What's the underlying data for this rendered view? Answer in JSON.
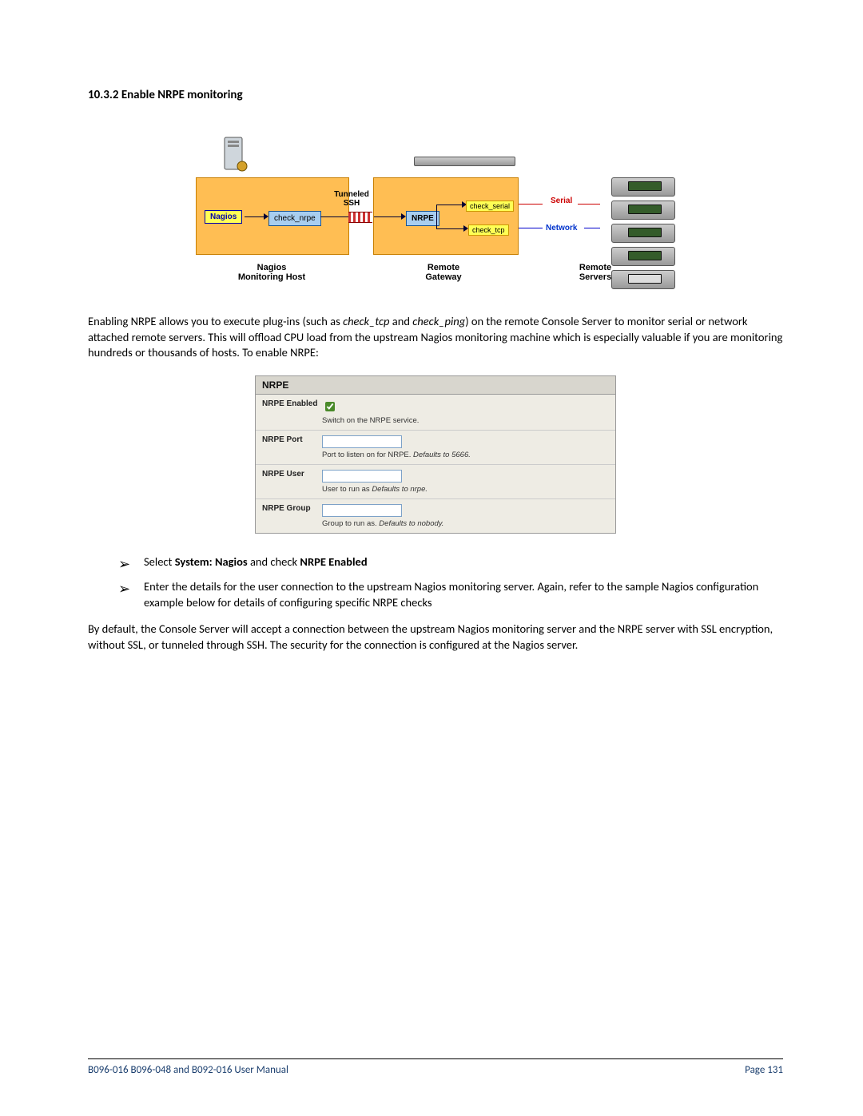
{
  "heading": "10.3.2  Enable NRPE monitoring",
  "diagram": {
    "nagios": "Nagios",
    "check_nrpe": "check_nrpe",
    "nrpe": "NRPE",
    "tunneled": "Tunneled\nSSH",
    "check_serial": "check_serial",
    "check_tcp": "check_tcp",
    "serial": "Serial",
    "network": "Network",
    "label_host": "Nagios\nMonitoring Host",
    "label_gateway": "Remote\nGateway",
    "label_servers": "Remote\nServers"
  },
  "para1_a": "Enabling NRPE allows you to execute plug-ins (such as ",
  "para1_i1": "check_tcp",
  "para1_b": " and ",
  "para1_i2": "check_ping",
  "para1_c": ") on the remote Console Server to monitor serial or network attached remote servers. This will offload CPU load from the upstream Nagios monitoring machine which is especially valuable if you are monitoring hundreds or thousands of hosts. To enable NRPE:",
  "form": {
    "title": "NRPE",
    "rows": {
      "enabled": {
        "label": "NRPE Enabled",
        "help": "Switch on the NRPE service."
      },
      "port": {
        "label": "NRPE Port",
        "help_a": "Port to listen on for NRPE. ",
        "help_i": "Defaults to 5666."
      },
      "user": {
        "label": "NRPE User",
        "help_a": "User to run as ",
        "help_i": "Defaults to nrpe."
      },
      "group": {
        "label": "NRPE Group",
        "help_a": "Group to run as. ",
        "help_i": "Defaults to nobody."
      }
    }
  },
  "bullets": {
    "b1_a": "Select ",
    "b1_b": "System: Nagios",
    "b1_c": " and check ",
    "b1_d": "NRPE Enabled",
    "b2": "Enter the details for the user connection to the upstream Nagios monitoring server. Again, refer to the sample Nagios configuration example below for details of configuring specific NRPE checks"
  },
  "para2": "By default, the Console Server will accept a connection between the upstream Nagios monitoring server and the NRPE server with SSL encryption, without SSL, or tunneled through SSH. The security for the connection is configured at the Nagios server.",
  "footer": {
    "left": "B096-016 B096-048 and B092-016 User Manual",
    "right": "Page 131"
  }
}
